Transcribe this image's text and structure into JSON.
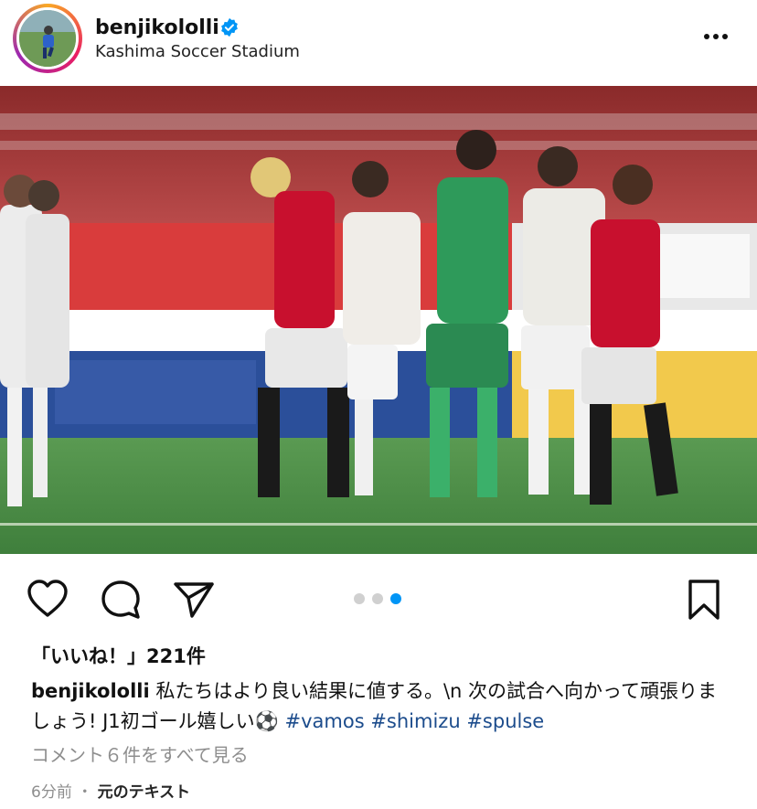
{
  "post": {
    "username": "benjikololli",
    "verified": true,
    "location": "Kashima Soccer Stadium",
    "image_alt": "",
    "carousel": {
      "count": 3,
      "active_index": 2
    },
    "likes_text": "「いいね！」221件",
    "caption": {
      "username": "benjikololli",
      "text": "私たちはより良い結果に値する。\\n 次の試合へ向かって頑張りましょう! J1初ゴール嬉しい",
      "emoji": "⚽",
      "hashtags": [
        "#vamos",
        "#shimizu",
        "#spulse"
      ]
    },
    "view_comments": "コメント６件をすべて見る",
    "time_ago": "6分前",
    "separator": "・",
    "see_translation": "元のテキスト"
  },
  "icons": {
    "more": "more-horizontal-icon",
    "like": "heart-icon",
    "comment": "comment-bubble-icon",
    "share": "paper-plane-icon",
    "save": "bookmark-icon",
    "verified": "verified-badge-icon"
  },
  "colors": {
    "verified_blue": "#0095f6",
    "hashtag": "#1c4c8c",
    "muted": "#8e8e8e",
    "home_red": "#c8102e"
  }
}
